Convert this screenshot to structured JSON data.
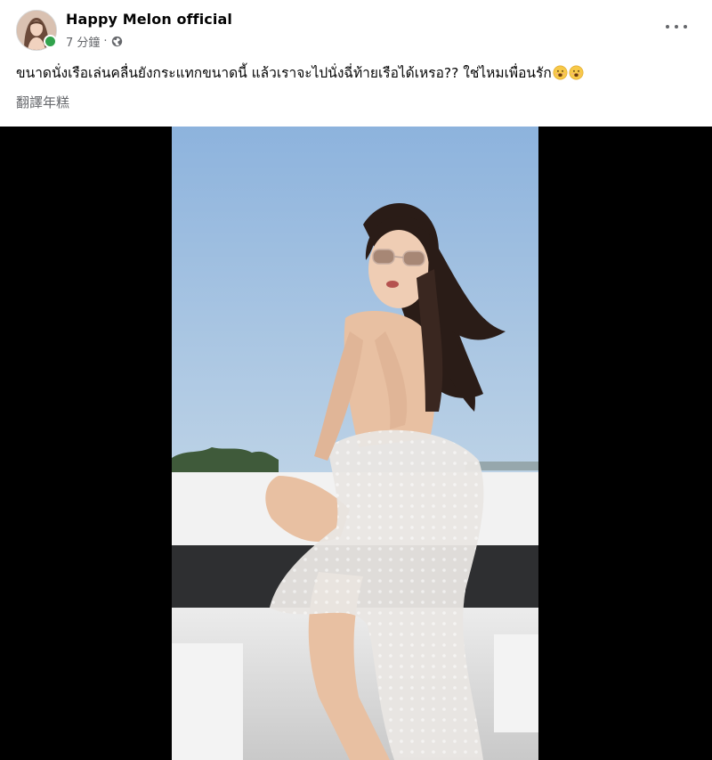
{
  "post": {
    "author": "Happy Melon official",
    "time": "7 分鐘",
    "separator": "·",
    "privacy_icon": "globe-icon",
    "more_icon": "more-options-icon",
    "caption_text": "ขนาดนั่งเรือเล่นคลื่นยังกระแทกขนาดนี้  แล้วเราจะไปนั่งฉี่ท้ายเรือได้เหรอ??   ใช่ไหมเพื่อนรัก",
    "caption_emojis": [
      "hushed-face-emoji",
      "hushed-face-emoji"
    ],
    "translate_label": "翻譯年糕"
  },
  "colors": {
    "online": "#31a24c",
    "secondary_text": "#65676b",
    "primary_text": "#050505",
    "video_letterbox": "#000000",
    "sky": "#a9c6e6"
  }
}
